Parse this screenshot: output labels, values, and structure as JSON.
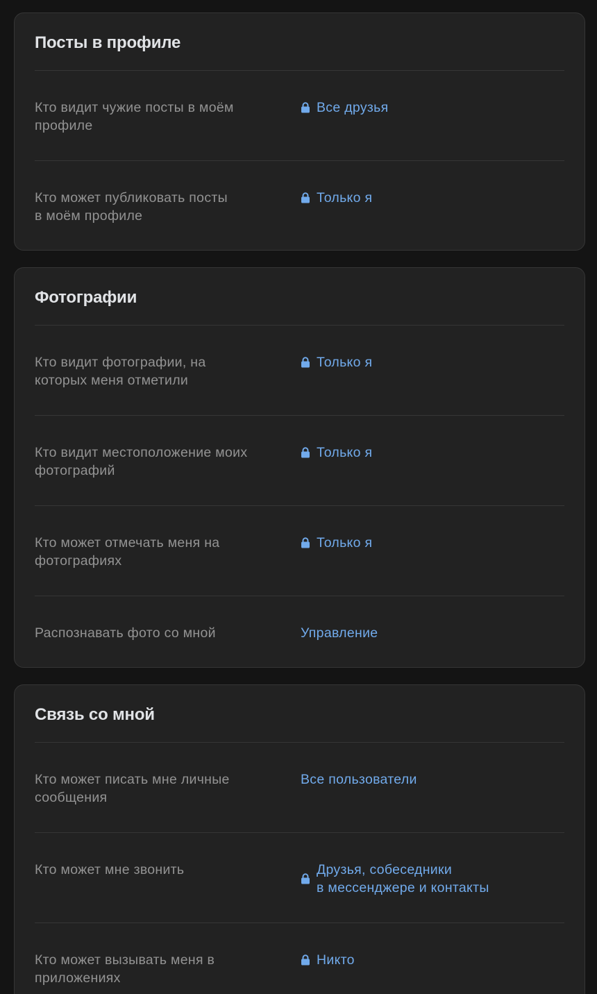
{
  "sections": [
    {
      "title": "Посты в профиле",
      "rows": [
        {
          "label": "Кто видит чужие посты в моём\nпрофиле",
          "value": "Все друзья",
          "locked": true
        },
        {
          "label": "Кто может публиковать посты\nв моём профиле",
          "value": "Только я",
          "locked": true
        }
      ]
    },
    {
      "title": "Фотографии",
      "rows": [
        {
          "label": "Кто видит фотографии, на\nкоторых меня отметили",
          "value": "Только я",
          "locked": true
        },
        {
          "label": "Кто видит местоположение моих\nфотографий",
          "value": "Только я",
          "locked": true
        },
        {
          "label": "Кто может отмечать меня на\nфотографиях",
          "value": "Только я",
          "locked": true
        },
        {
          "label": "Распознавать фото со мной",
          "value": "Управление",
          "locked": false
        }
      ]
    },
    {
      "title": "Связь со мной",
      "rows": [
        {
          "label": "Кто может писать мне личные\nсообщения",
          "value": "Все пользователи",
          "locked": false
        },
        {
          "label": "Кто может мне звонить",
          "value": "Друзья, собеседники\nв мессенджере и контакты",
          "locked": true
        },
        {
          "label": "Кто может вызывать меня в\nприложениях",
          "value": "Никто",
          "locked": true
        }
      ]
    }
  ],
  "icons": {
    "lock": "lock-icon"
  },
  "colors": {
    "background": "#141414",
    "card": "#222222",
    "card_border": "#363636",
    "title": "#e1e3e6",
    "label": "#939393",
    "link": "#71aaeb"
  }
}
